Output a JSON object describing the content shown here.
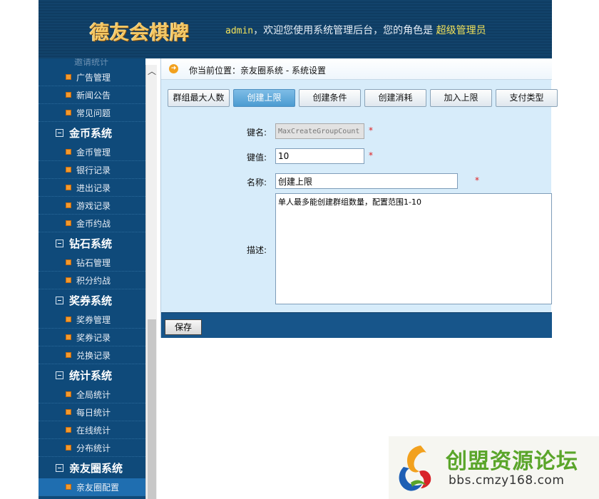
{
  "header": {
    "logo_text": "德友会棋牌",
    "welcome_user": "admin",
    "welcome_text": "，欢迎您使用系统管理后台，您的角色是 ",
    "role": "超级管理员"
  },
  "sidebar": {
    "cut_item": "邀请统计",
    "entries": [
      {
        "kind": "item",
        "label": "广告管理"
      },
      {
        "kind": "item",
        "label": "新闻公告"
      },
      {
        "kind": "item",
        "label": "常见问题"
      },
      {
        "kind": "group",
        "label": "金币系统"
      },
      {
        "kind": "item",
        "label": "金币管理"
      },
      {
        "kind": "item",
        "label": "银行记录"
      },
      {
        "kind": "item",
        "label": "进出记录"
      },
      {
        "kind": "item",
        "label": "游戏记录"
      },
      {
        "kind": "item",
        "label": "金币约战"
      },
      {
        "kind": "group",
        "label": "钻石系统"
      },
      {
        "kind": "item",
        "label": "钻石管理"
      },
      {
        "kind": "item",
        "label": "积分约战"
      },
      {
        "kind": "group",
        "label": "奖券系统"
      },
      {
        "kind": "item",
        "label": "奖券管理"
      },
      {
        "kind": "item",
        "label": "奖券记录"
      },
      {
        "kind": "item",
        "label": "兑换记录"
      },
      {
        "kind": "group",
        "label": "统计系统"
      },
      {
        "kind": "item",
        "label": "全局统计"
      },
      {
        "kind": "item",
        "label": "每日统计"
      },
      {
        "kind": "item",
        "label": "在线统计"
      },
      {
        "kind": "item",
        "label": "分布统计"
      },
      {
        "kind": "group",
        "label": "亲友圈系统"
      },
      {
        "kind": "item",
        "label": "亲友圈配置",
        "active": true
      }
    ]
  },
  "breadcrumb": {
    "icon": "arrow-right-icon",
    "text": "你当前位置：亲友圈系统 - 系统设置"
  },
  "tabs": [
    {
      "label": "群组最大人数",
      "active": false
    },
    {
      "label": "创建上限",
      "active": true
    },
    {
      "label": "创建条件",
      "active": false
    },
    {
      "label": "创建消耗",
      "active": false
    },
    {
      "label": "加入上限",
      "active": false
    },
    {
      "label": "支付类型",
      "active": false
    }
  ],
  "form": {
    "key_label": "键名:",
    "key_value": "MaxCreateGroupCount",
    "value_label": "键值:",
    "value_value": "10",
    "name_label": "名称:",
    "name_value": "创建上限",
    "desc_label": "描述:",
    "desc_value": "单人最多能创建群组数量，配置范围1-10",
    "required_mark": "*"
  },
  "actions": {
    "save_label": "保存"
  },
  "watermark": {
    "title": "创盟资源论坛",
    "url": "bbs.cmzy168.com"
  },
  "colors": {
    "header_bg": "#12436b",
    "sidebar_bg": "#0f4a7a",
    "content_bg": "#d7ecfa",
    "active_tab": "#4b9bd1",
    "bullet": "#f29a2e",
    "required": "#e02020",
    "role_highlight": "#f3e25a"
  }
}
